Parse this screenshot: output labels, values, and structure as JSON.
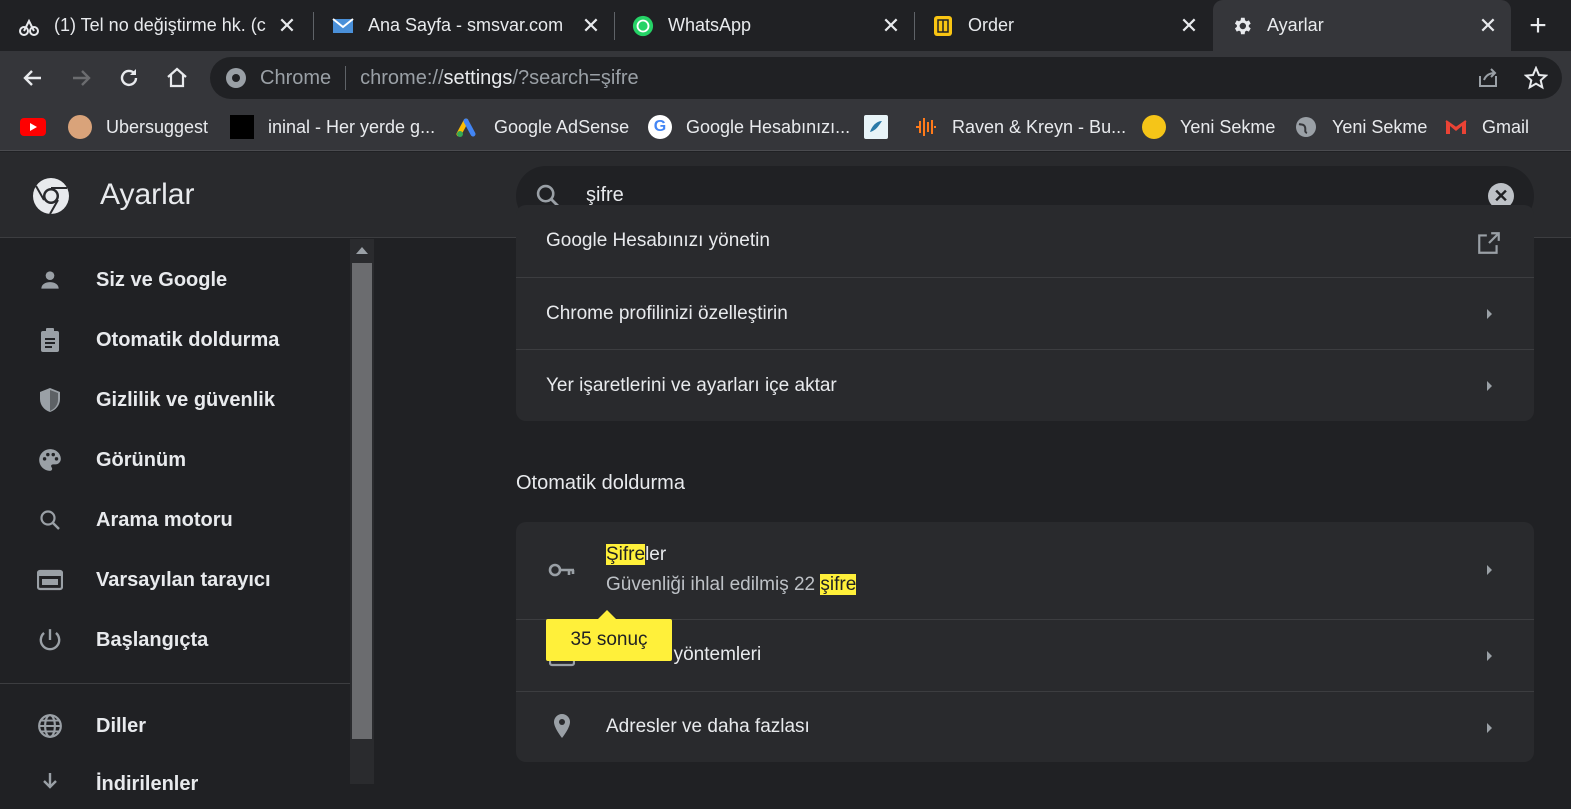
{
  "tabs": [
    {
      "title": "(1) Tel no değiştirme hk. (c",
      "icon": "moped-icon"
    },
    {
      "title": "Ana Sayfa - smsvar.com",
      "icon": "mail-icon"
    },
    {
      "title": "WhatsApp",
      "icon": "whatsapp-icon"
    },
    {
      "title": "Order",
      "icon": "sim-card-icon"
    },
    {
      "title": "Ayarlar",
      "icon": "gear-icon",
      "active": true
    }
  ],
  "omnibox": {
    "scheme_label": "Chrome",
    "url_prefix": "chrome://",
    "url_host": "settings",
    "url_suffix": "/?search=şifre"
  },
  "bookmarks": [
    {
      "label": "",
      "icon": "youtube-icon"
    },
    {
      "label": "Ubersuggest",
      "icon": "avatar-icon"
    },
    {
      "label": "ininal - Her yerde g...",
      "icon": "ininal-icon"
    },
    {
      "label": "Google AdSense",
      "icon": "adsense-icon"
    },
    {
      "label": "Google Hesabınızı...",
      "icon": "google-icon"
    },
    {
      "label": "",
      "icon": "site-icon"
    },
    {
      "label": "Raven & Kreyn - Bu...",
      "icon": "audio-wave-icon"
    },
    {
      "label": "Yeni Sekme",
      "icon": "emoji-icon"
    },
    {
      "label": "Yeni Sekme",
      "icon": "globe-icon"
    },
    {
      "label": "Gmail",
      "icon": "gmail-icon"
    }
  ],
  "settings": {
    "title": "Ayarlar",
    "search_value": "şifre"
  },
  "sidebar": {
    "items": [
      {
        "label": "Siz ve Google",
        "icon": "person-icon"
      },
      {
        "label": "Otomatik doldurma",
        "icon": "clipboard-icon"
      },
      {
        "label": "Gizlilik ve güvenlik",
        "icon": "shield-icon"
      },
      {
        "label": "Görünüm",
        "icon": "palette-icon"
      },
      {
        "label": "Arama motoru",
        "icon": "search-icon"
      },
      {
        "label": "Varsayılan tarayıcı",
        "icon": "browser-icon"
      },
      {
        "label": "Başlangıçta",
        "icon": "power-icon"
      },
      {
        "label": "Diller",
        "icon": "globe-icon"
      },
      {
        "label": "İndirilenler",
        "icon": "download-icon"
      }
    ]
  },
  "main": {
    "account_rows": [
      {
        "label": "Google Hesabınızı yönetin"
      },
      {
        "label": "Chrome profilinizi özelleştirin"
      },
      {
        "label": "Yer işaretlerini ve ayarları içe aktar"
      }
    ],
    "autofill_title": "Otomatik doldurma",
    "passwords": {
      "label_highlight": "Şifre",
      "label_rest": "ler",
      "sub_prefix": "Güvenliği ihlal edilmiş 22 ",
      "sub_highlight": "şifre"
    },
    "payment_label": "Ödeme yöntemleri",
    "addresses_label": "Adresler ve daha fazlası",
    "tooltip": "35 sonuç"
  },
  "colors": {
    "highlight": "#fff03a",
    "background": "#202124",
    "card": "#292a2d"
  }
}
